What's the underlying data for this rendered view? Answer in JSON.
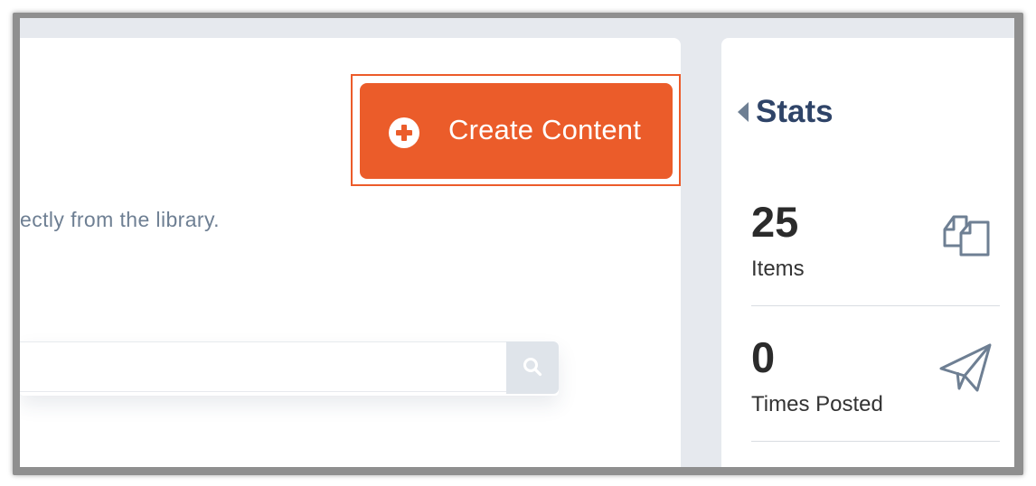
{
  "actions": {
    "create_label": "Create Content"
  },
  "library": {
    "description": "ectly from the library.",
    "search_placeholder": ""
  },
  "stats": {
    "title": "Stats",
    "items": [
      {
        "value": "25",
        "label": "Items",
        "icon": "copy-icon"
      },
      {
        "value": "0",
        "label": "Times Posted",
        "icon": "paper-plane-icon"
      }
    ]
  },
  "colors": {
    "accent": "#eb5c2a",
    "title": "#2f4468",
    "muted": "#6e7f93",
    "background": "#e6e9ee"
  }
}
